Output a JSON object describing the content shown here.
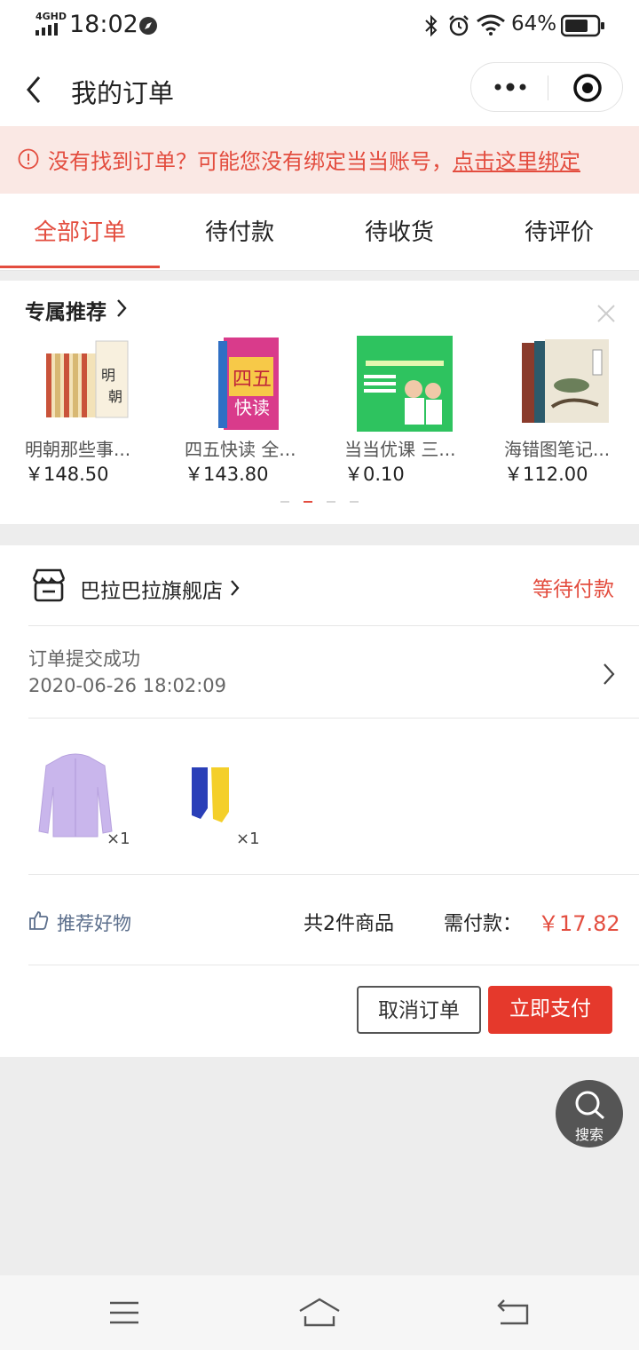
{
  "status_bar": {
    "network": "4GHD",
    "time": "18:02",
    "battery": "64%"
  },
  "nav": {
    "title": "我的订单"
  },
  "notice": {
    "text": "没有找到订单？可能您没有绑定当当账号，",
    "link": "点击这里绑定"
  },
  "tabs": [
    {
      "label": "全部订单",
      "active": true
    },
    {
      "label": "待付款",
      "active": false
    },
    {
      "label": "待收货",
      "active": false
    },
    {
      "label": "待评价",
      "active": false
    }
  ],
  "recommend": {
    "title": "专属推荐",
    "items": [
      {
        "name": "明朝那些事...",
        "price": "￥148.50"
      },
      {
        "name": "四五快读 全...",
        "price": "￥143.80"
      },
      {
        "name": "当当优课 三...",
        "price": "￥0.10"
      },
      {
        "name": "海错图笔记...",
        "price": "￥112.00"
      }
    ]
  },
  "order": {
    "shop_name": "巴拉巴拉旗舰店",
    "status": "等待付款",
    "sub_title": "订单提交成功",
    "sub_time": "2020-06-26 18:02:09",
    "items": [
      {
        "qty": "×1"
      },
      {
        "qty": "×1"
      }
    ],
    "recommend_link": "推荐好物",
    "total_count": "共2件商品",
    "pay_label": "需付款：",
    "pay_amount": "￥17.82",
    "cancel_label": "取消订单",
    "pay_button": "立即支付"
  },
  "fab": {
    "label": "搜索"
  },
  "colors": {
    "accent": "#e34d3f",
    "notice_bg": "#fae8e4"
  }
}
